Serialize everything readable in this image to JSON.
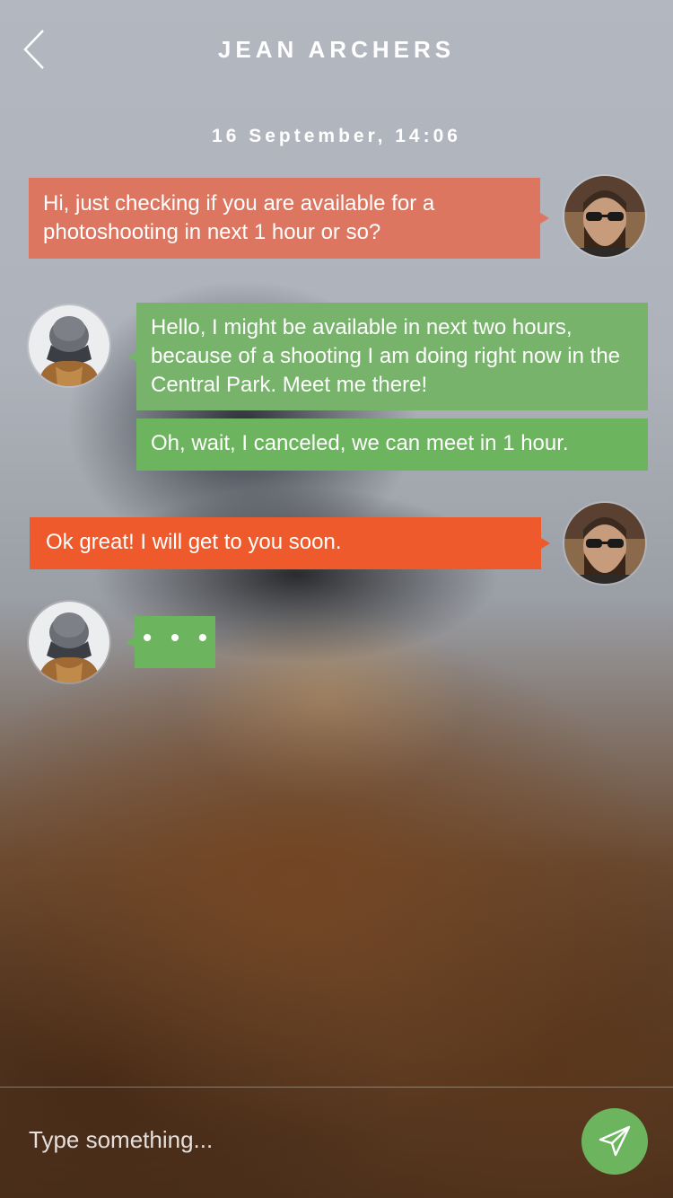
{
  "header": {
    "title": "JEAN ARCHERS",
    "back_icon": "chevron-left-icon"
  },
  "conversation": {
    "date": "16 September, 14:06",
    "messages": [
      {
        "from": "me",
        "text": "Hi, just checking if you are available for a photoshooting in next 1 hour or so?"
      },
      {
        "from": "contact",
        "text": "Hello, I might be available in next two hours, because of a shooting I am doing right now in the Central Park. Meet me there!"
      },
      {
        "from": "contact",
        "text": "Oh, wait, I canceled, we can meet in 1 hour."
      },
      {
        "from": "me",
        "text": "Ok great! I will get to you soon."
      },
      {
        "from": "contact",
        "text": "• • •",
        "typing": true
      }
    ]
  },
  "composer": {
    "placeholder": "Type something...",
    "send_icon": "paper-plane-icon"
  },
  "colors": {
    "bubble_sent_light": "#dd7661",
    "bubble_sent": "#ee5a2c",
    "bubble_received": "#77b36a",
    "accent_green": "#6cb55e"
  }
}
